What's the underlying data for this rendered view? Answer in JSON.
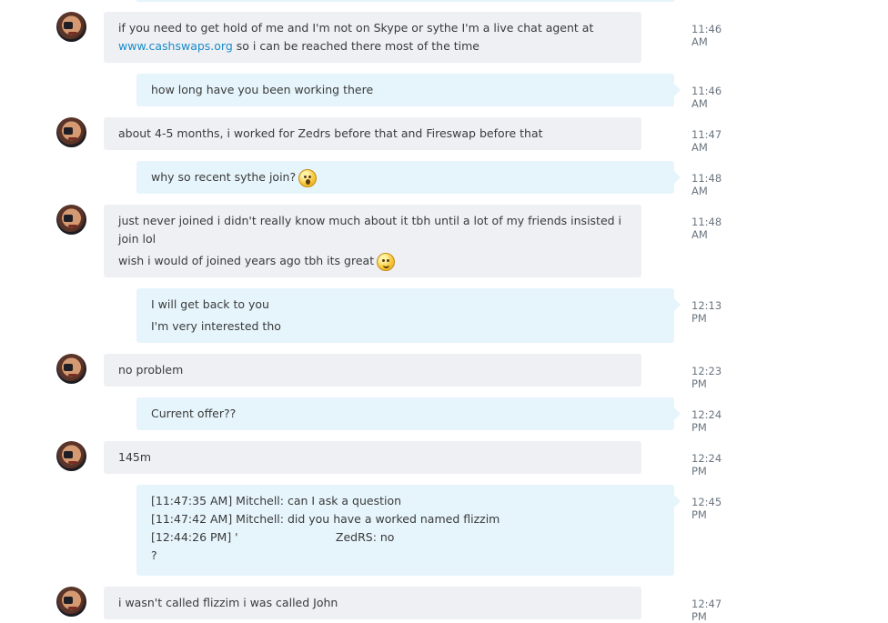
{
  "messages": [
    {
      "dir": "in",
      "time": "11:46 AM",
      "lines": [
        "if you need to get hold of me and I'm not on Skype or sythe I'm a live chat agent at"
      ],
      "link": {
        "text": "www.cashswaps.org",
        "after": " so i can be reached there most of the time"
      }
    },
    {
      "dir": "out",
      "time": "11:46 AM",
      "lines": [
        "how long have you been working there"
      ]
    },
    {
      "dir": "in",
      "time": "11:47 AM",
      "lines": [
        "about 4-5 months, i worked for Zedrs before that and Fireswap before that"
      ]
    },
    {
      "dir": "out",
      "time": "11:48 AM",
      "lines": [
        "why so recent sythe join?"
      ],
      "emoticon": "surprised-emoticon"
    },
    {
      "dir": "in",
      "time": "11:48 AM",
      "lines": [
        "just never joined i didn't really know much about it tbh until a lot of my friends insisted i join lol",
        "wish i would of joined years ago tbh its great"
      ],
      "emoticon": "smile-emoticon"
    },
    {
      "dir": "out",
      "time": "12:13 PM",
      "lines": [
        "I will get back to you",
        "I'm very interested tho"
      ]
    },
    {
      "dir": "in",
      "time": "12:23 PM",
      "lines": [
        "no problem"
      ]
    },
    {
      "dir": "out",
      "time": "12:24 PM",
      "lines": [
        "Current offer??"
      ]
    },
    {
      "dir": "in",
      "time": "12:24 PM",
      "lines": [
        "145m"
      ]
    },
    {
      "dir": "out",
      "time": "12:45 PM",
      "lines": [
        "[11:47:35 AM] Mitchell: can I ask a question",
        "[11:47:42 AM] Mitchell: did you have a worked named flizzim",
        "[12:44:26 PM] '                           ZedRS: no",
        "?"
      ]
    },
    {
      "dir": "in",
      "time": "12:47 PM",
      "lines": [
        "i wasn't called flizzim i was called John"
      ]
    }
  ]
}
